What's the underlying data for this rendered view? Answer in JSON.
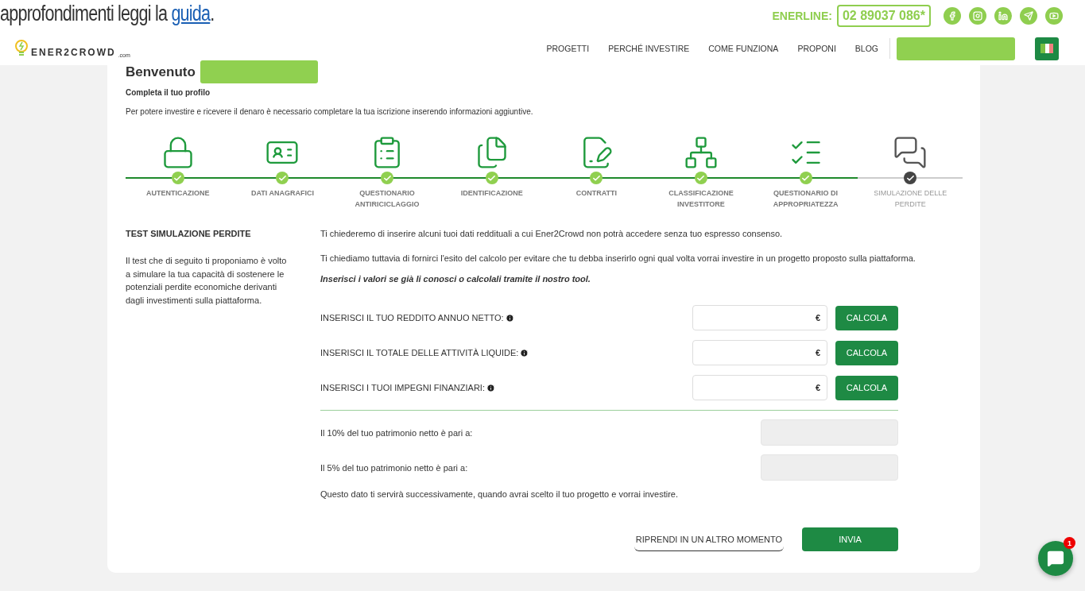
{
  "banner": {
    "text": "approfondimenti leggi la",
    "link": "guida",
    "end": "."
  },
  "contact": {
    "label": "ENERLINE:",
    "phone": "02 89037 086*"
  },
  "logo": {
    "text": "ENER2CROWD",
    "suffix": ".com"
  },
  "nav": [
    "PROGETTI",
    "PERCHÉ INVESTIRE",
    "COME FUNZIONA",
    "PROPONI",
    "BLOG"
  ],
  "welcome": {
    "title": "Benvenuto",
    "subtitle": "Completa il tuo profilo",
    "intro": "Per potere investire e ricevere il denaro è necessario completare la tua iscrizione inserendo informazioni aggiuntive."
  },
  "steps": [
    {
      "kind": "lock",
      "label": "AUTENTICAZIONE",
      "selected": false
    },
    {
      "kind": "profile",
      "label": "DATI ANAGRAFICI",
      "selected": false
    },
    {
      "kind": "questionnaire",
      "label": "QUESTIONARIO ANTIRICICLAGGIO",
      "selected": false
    },
    {
      "kind": "documents",
      "label": "IDENTIFICAZIONE",
      "selected": false
    },
    {
      "kind": "contract",
      "label": "CONTRATTI",
      "selected": false
    },
    {
      "kind": "hierarchy",
      "label": "CLASSIFICAZIONE INVESTITORE",
      "selected": false
    },
    {
      "kind": "checklist",
      "label": "QUESTIONARIO DI APPROPRIATEZZA",
      "selected": false
    },
    {
      "kind": "chat",
      "label": "SIMULAZIONE DELLE PERDITE",
      "selected": true
    }
  ],
  "side": {
    "title": "TEST SIMULAZIONE PERDITE",
    "text": "Il test che di seguito ti proponiamo è volto a simulare la tua capacità di sostenere le potenziali perdite economiche derivanti dagli investimenti sulla piattaforma."
  },
  "paragraphs": [
    "Ti chiederemo di inserire alcuni tuoi dati reddituali a cui Ener2Crowd non potrà accedere senza tuo espresso consenso.",
    "Ti chiediamo tuttavia di fornirci l'esito del calcolo per evitare che tu debba inserirlo ogni qual volta vorrai investire in un progetto proposto sulla piattaforma."
  ],
  "hint": "Inserisci i valori se già li conosci o calcolali tramite il nostro tool.",
  "inputs": [
    {
      "label": "INSERISCI IL TUO REDDITO ANNUO NETTO:",
      "unit": "€",
      "button": "CALCOLA"
    },
    {
      "label": "INSERISCI IL TOTALE DELLE ATTIVITÀ LIQUIDE:",
      "unit": "€",
      "button": "CALCOLA"
    },
    {
      "label": "INSERISCI I TUOI IMPEGNI FINANZIARI:",
      "unit": "€",
      "button": "CALCOLA"
    }
  ],
  "results": [
    {
      "label": "Il 10% del tuo patrimonio netto è pari a:"
    },
    {
      "label": "Il 5% del tuo patrimonio netto è pari a:"
    }
  ],
  "note": "Questo dato ti servirà successivamente, quando avrai scelto il tuo progetto e vorrai investire.",
  "actions": {
    "later": "RIPRENDI IN UN ALTRO MOMENTO",
    "submit": "INVIA"
  },
  "chat": {
    "badge": "1"
  }
}
